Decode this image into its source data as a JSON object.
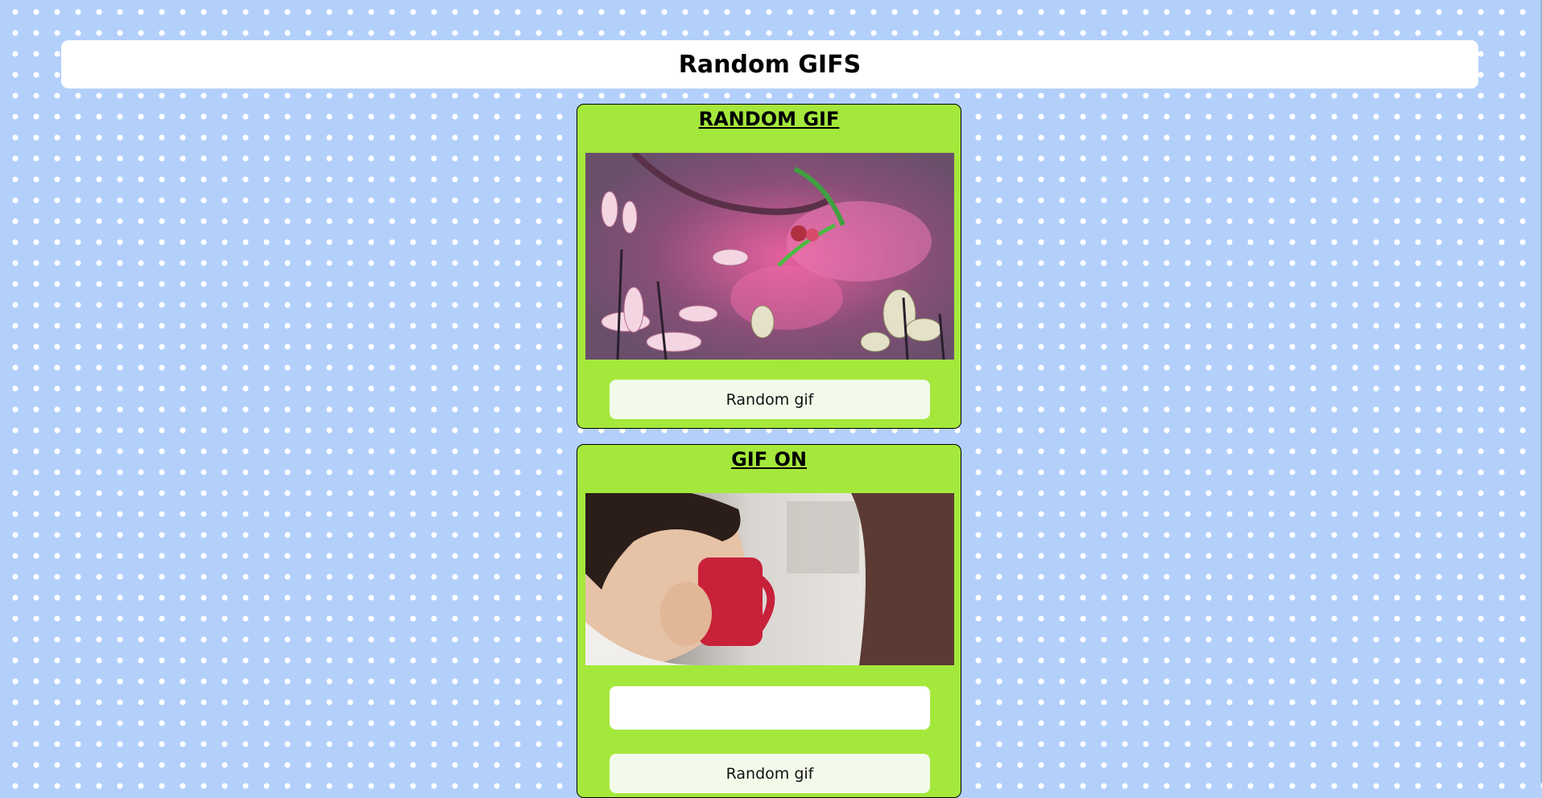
{
  "header": {
    "title": "Random GIFS"
  },
  "random_card": {
    "title": "RANDOM GIF",
    "gif_icon": "gif-image",
    "button_label": "Random gif"
  },
  "tag_card": {
    "title": "GIF ON",
    "gif_icon": "gif-image",
    "search_value": "",
    "search_placeholder": "",
    "button_label": "Random gif"
  },
  "colors": {
    "background": "#b3d0fb",
    "card": "#a4e83c",
    "button": "#f2faea"
  }
}
